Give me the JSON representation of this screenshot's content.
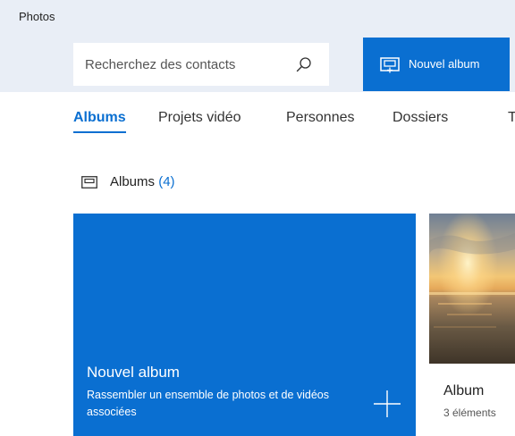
{
  "app": {
    "title": "Photos"
  },
  "search": {
    "placeholder": "Recherchez des contacts"
  },
  "toolbar": {
    "new_album_label": "Nouvel album"
  },
  "tabs": [
    {
      "label": "Albums",
      "active": true
    },
    {
      "label": "Projets vidéo",
      "active": false
    },
    {
      "label": "Personnes",
      "active": false
    },
    {
      "label": "Dossiers",
      "active": false
    },
    {
      "label": "T",
      "active": false
    }
  ],
  "section": {
    "label": "Albums",
    "count": "(4)"
  },
  "new_album_tile": {
    "title": "Nouvel album",
    "description": "Rassembler un ensemble de photos et de vidéos associées"
  },
  "albums": [
    {
      "name": "Album",
      "count": "3 éléments"
    }
  ],
  "colors": {
    "accent": "#0a6fd1",
    "header_background": "#e9eef6"
  },
  "icons": {
    "search": "search-icon",
    "new_album": "album-add-icon",
    "section": "album-icon",
    "tile_add": "plus-icon"
  }
}
